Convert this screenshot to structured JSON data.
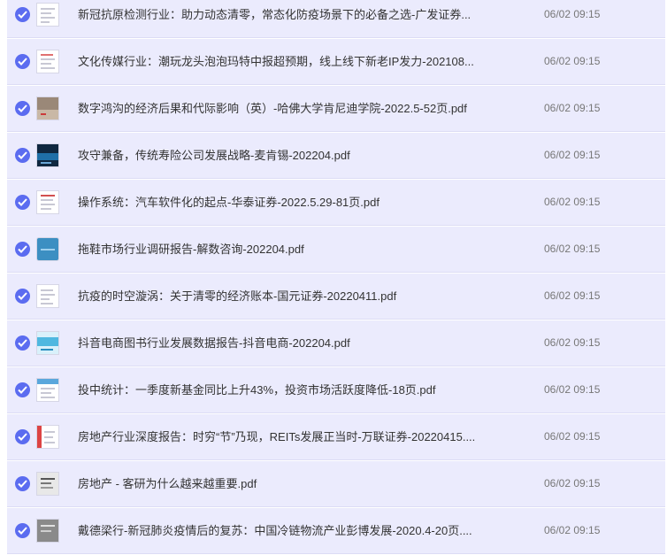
{
  "files": [
    {
      "name": "新冠抗原检测行业：助力动态清零，常态化防疫场景下的必备之选-广发证券...",
      "time": "06/02 09:15",
      "icon": "doc-thumbnail-white"
    },
    {
      "name": "文化传媒行业：潮玩龙头泡泡玛特中报超预期，线上线下新老IP发力-202108...",
      "time": "06/02 09:15",
      "icon": "doc-thumbnail-white"
    },
    {
      "name": "数字鸿沟的经济后果和代际影响（英）-哈佛大学肯尼迪学院-2022.5-52页.pdf",
      "time": "06/02 09:15",
      "icon": "doc-thumbnail-photo"
    },
    {
      "name": "攻守兼备，传统寿险公司发展战略-麦肯锡-202204.pdf",
      "time": "06/02 09:15",
      "icon": "doc-thumbnail-dark"
    },
    {
      "name": "操作系统：汽车软件化的起点-华泰证券-2022.5.29-81页.pdf",
      "time": "06/02 09:15",
      "icon": "doc-thumbnail-white"
    },
    {
      "name": "拖鞋市场行业调研报告-解数咨询-202204.pdf",
      "time": "06/02 09:15",
      "icon": "doc-thumbnail-blue"
    },
    {
      "name": "抗疫的时空漩涡：关于清零的经济账本-国元证券-20220411.pdf",
      "time": "06/02 09:15",
      "icon": "doc-thumbnail-white"
    },
    {
      "name": "抖音电商图书行业发展数据报告-抖音电商-202204.pdf",
      "time": "06/02 09:15",
      "icon": "doc-thumbnail-cyan"
    },
    {
      "name": "投中统计：一季度新基金同比上升43%，投资市场活跃度降低-18页.pdf",
      "time": "06/02 09:15",
      "icon": "doc-thumbnail-white"
    },
    {
      "name": "房地产行业深度报告：时穷“节”乃现，REITs发展正当时-万联证券-20220415....",
      "time": "06/02 09:15",
      "icon": "doc-thumbnail-white"
    },
    {
      "name": "房地产 - 客研为什么越来越重要.pdf",
      "time": "06/02 09:15",
      "icon": "doc-thumbnail-gray"
    },
    {
      "name": "戴德梁行-新冠肺炎疫情后的复苏：中国冷链物流产业彭博发展-2020.4-20页....",
      "time": "06/02 09:15",
      "icon": "doc-thumbnail-gray"
    }
  ]
}
